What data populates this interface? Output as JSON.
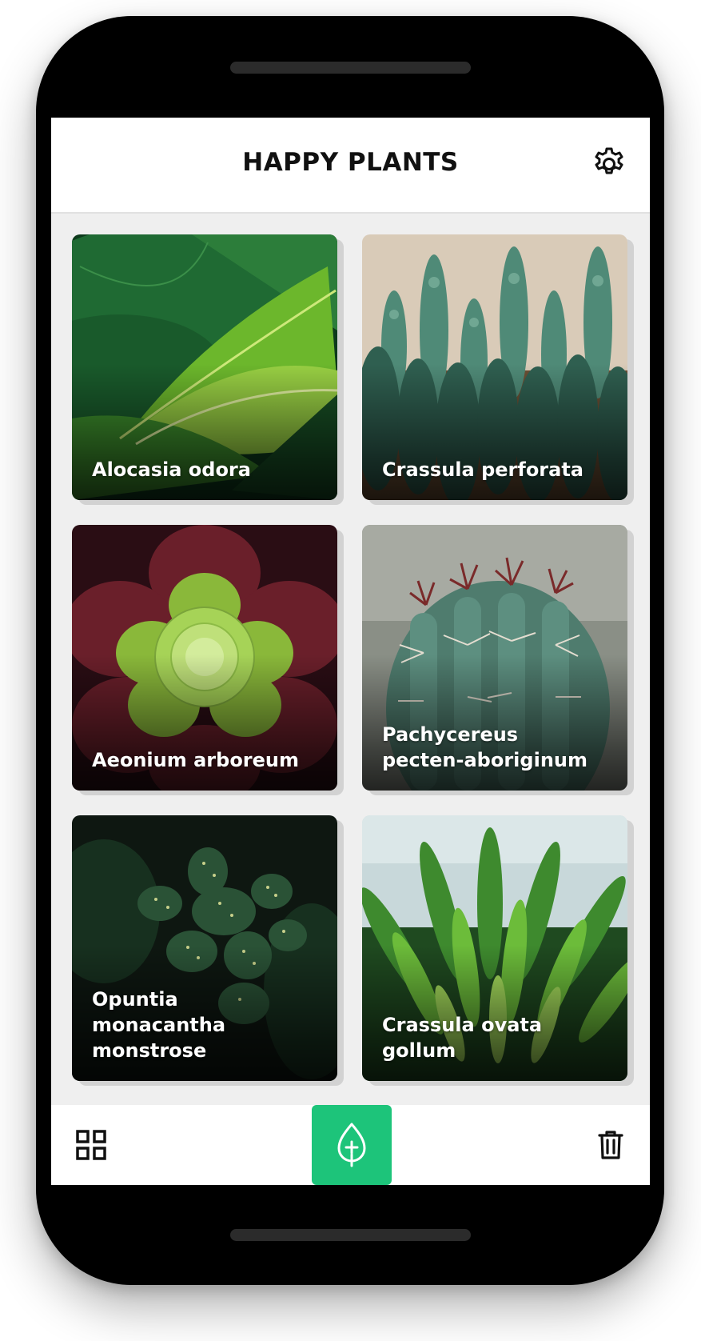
{
  "app": {
    "title": "HAPPY PLANTS",
    "accent_color": "#1dc47a"
  },
  "header": {
    "settings_icon": "gear-icon"
  },
  "plants": [
    {
      "name": "Alocasia odora"
    },
    {
      "name": "Crassula perforata"
    },
    {
      "name": "Aeonium arboreum"
    },
    {
      "name": "Pachycereus\npecten-aboriginum"
    },
    {
      "name": "Opuntia\nmonacantha\nmonstrose"
    },
    {
      "name": "Crassula ovata\ngollum"
    }
  ],
  "bottom_bar": {
    "left_icon": "grid-view-icon",
    "center_icon": "add-plant-icon",
    "right_icon": "trash-icon"
  }
}
